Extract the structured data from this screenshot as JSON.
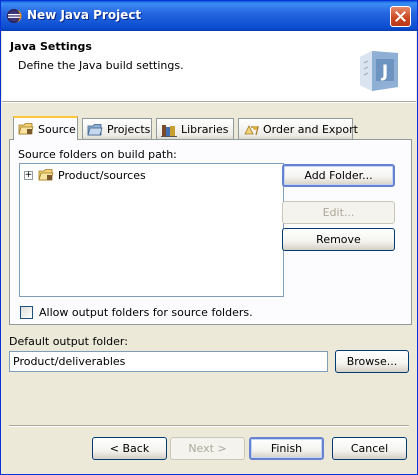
{
  "window": {
    "title": "New Java Project"
  },
  "banner": {
    "heading": "Java Settings",
    "description": "Define the Java build settings."
  },
  "tabs": [
    {
      "label": "Source",
      "icon": "source-folder-icon",
      "active": true
    },
    {
      "label": "Projects",
      "icon": "projects-icon",
      "active": false
    },
    {
      "label": "Libraries",
      "icon": "libraries-icon",
      "active": false
    },
    {
      "label": "Order and Export",
      "icon": "order-export-icon",
      "active": false
    }
  ],
  "source_panel": {
    "label": "Source folders on build path:",
    "tree_items": [
      {
        "label": "Product/sources",
        "expanded": false
      }
    ],
    "buttons": {
      "add": "Add Folder...",
      "edit": "Edit...",
      "remove": "Remove"
    },
    "allow_output_label": "Allow output folders for source folders.",
    "allow_output_checked": false
  },
  "output": {
    "label": "Default output folder:",
    "value": "Product/deliverables",
    "browse": "Browse..."
  },
  "footer": {
    "back": "< Back",
    "next": "Next >",
    "finish": "Finish",
    "cancel": "Cancel"
  },
  "colors": {
    "titlebar": "#0a5fd8",
    "dialog_bg": "#ece9d8",
    "active_tab_accent": "#ffc83c"
  }
}
